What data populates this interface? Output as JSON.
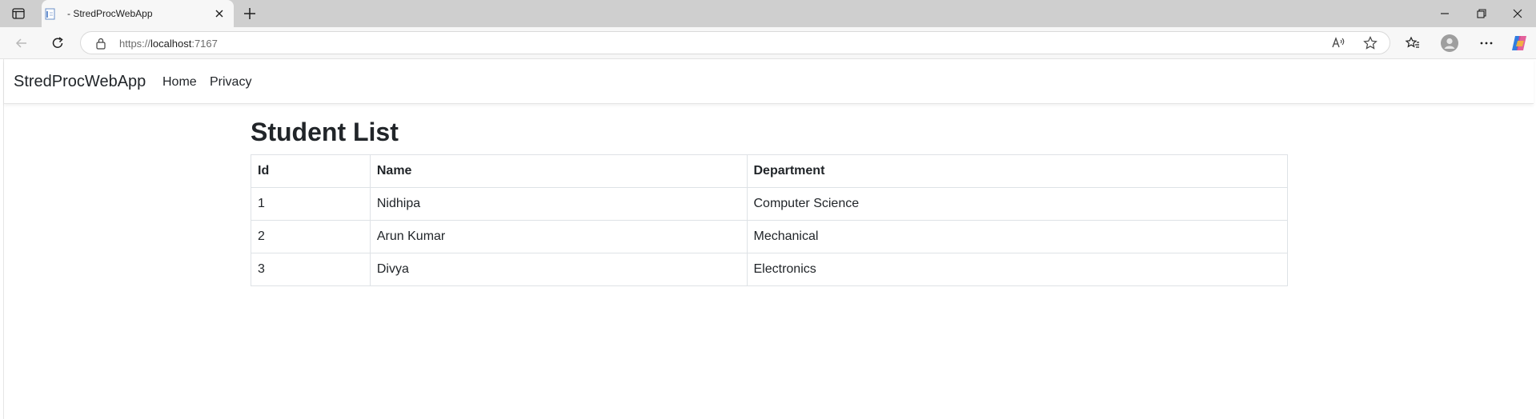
{
  "browser": {
    "tab_title": " - StredProcWebApp",
    "url_scheme": "https://",
    "url_host": "localhost",
    "url_port": ":7167",
    "icons": [
      "tab-actions-icon",
      "page-favicon-icon",
      "close-icon",
      "plus-icon",
      "back-icon",
      "refresh-icon",
      "lock-icon",
      "read-aloud-icon",
      "star-icon",
      "favorites-icon",
      "profile-icon",
      "more-icon",
      "copilot-icon",
      "minimize-icon",
      "restore-icon",
      "window-close-icon"
    ]
  },
  "navbar": {
    "brand": "StredProcWebApp",
    "links": [
      "Home",
      "Privacy"
    ]
  },
  "main": {
    "title": "Student List",
    "columns": [
      "Id",
      "Name",
      "Department"
    ],
    "rows": [
      [
        "1",
        "Nidhipa",
        "Computer Science"
      ],
      [
        "2",
        "Arun Kumar",
        "Mechanical"
      ],
      [
        "3",
        "Divya",
        "Electronics"
      ]
    ]
  },
  "colors": {
    "tabstrip": "#cfcfcf",
    "toolbar": "#f7f7f7",
    "text": "#212529",
    "table_border": "#dee2e6"
  }
}
